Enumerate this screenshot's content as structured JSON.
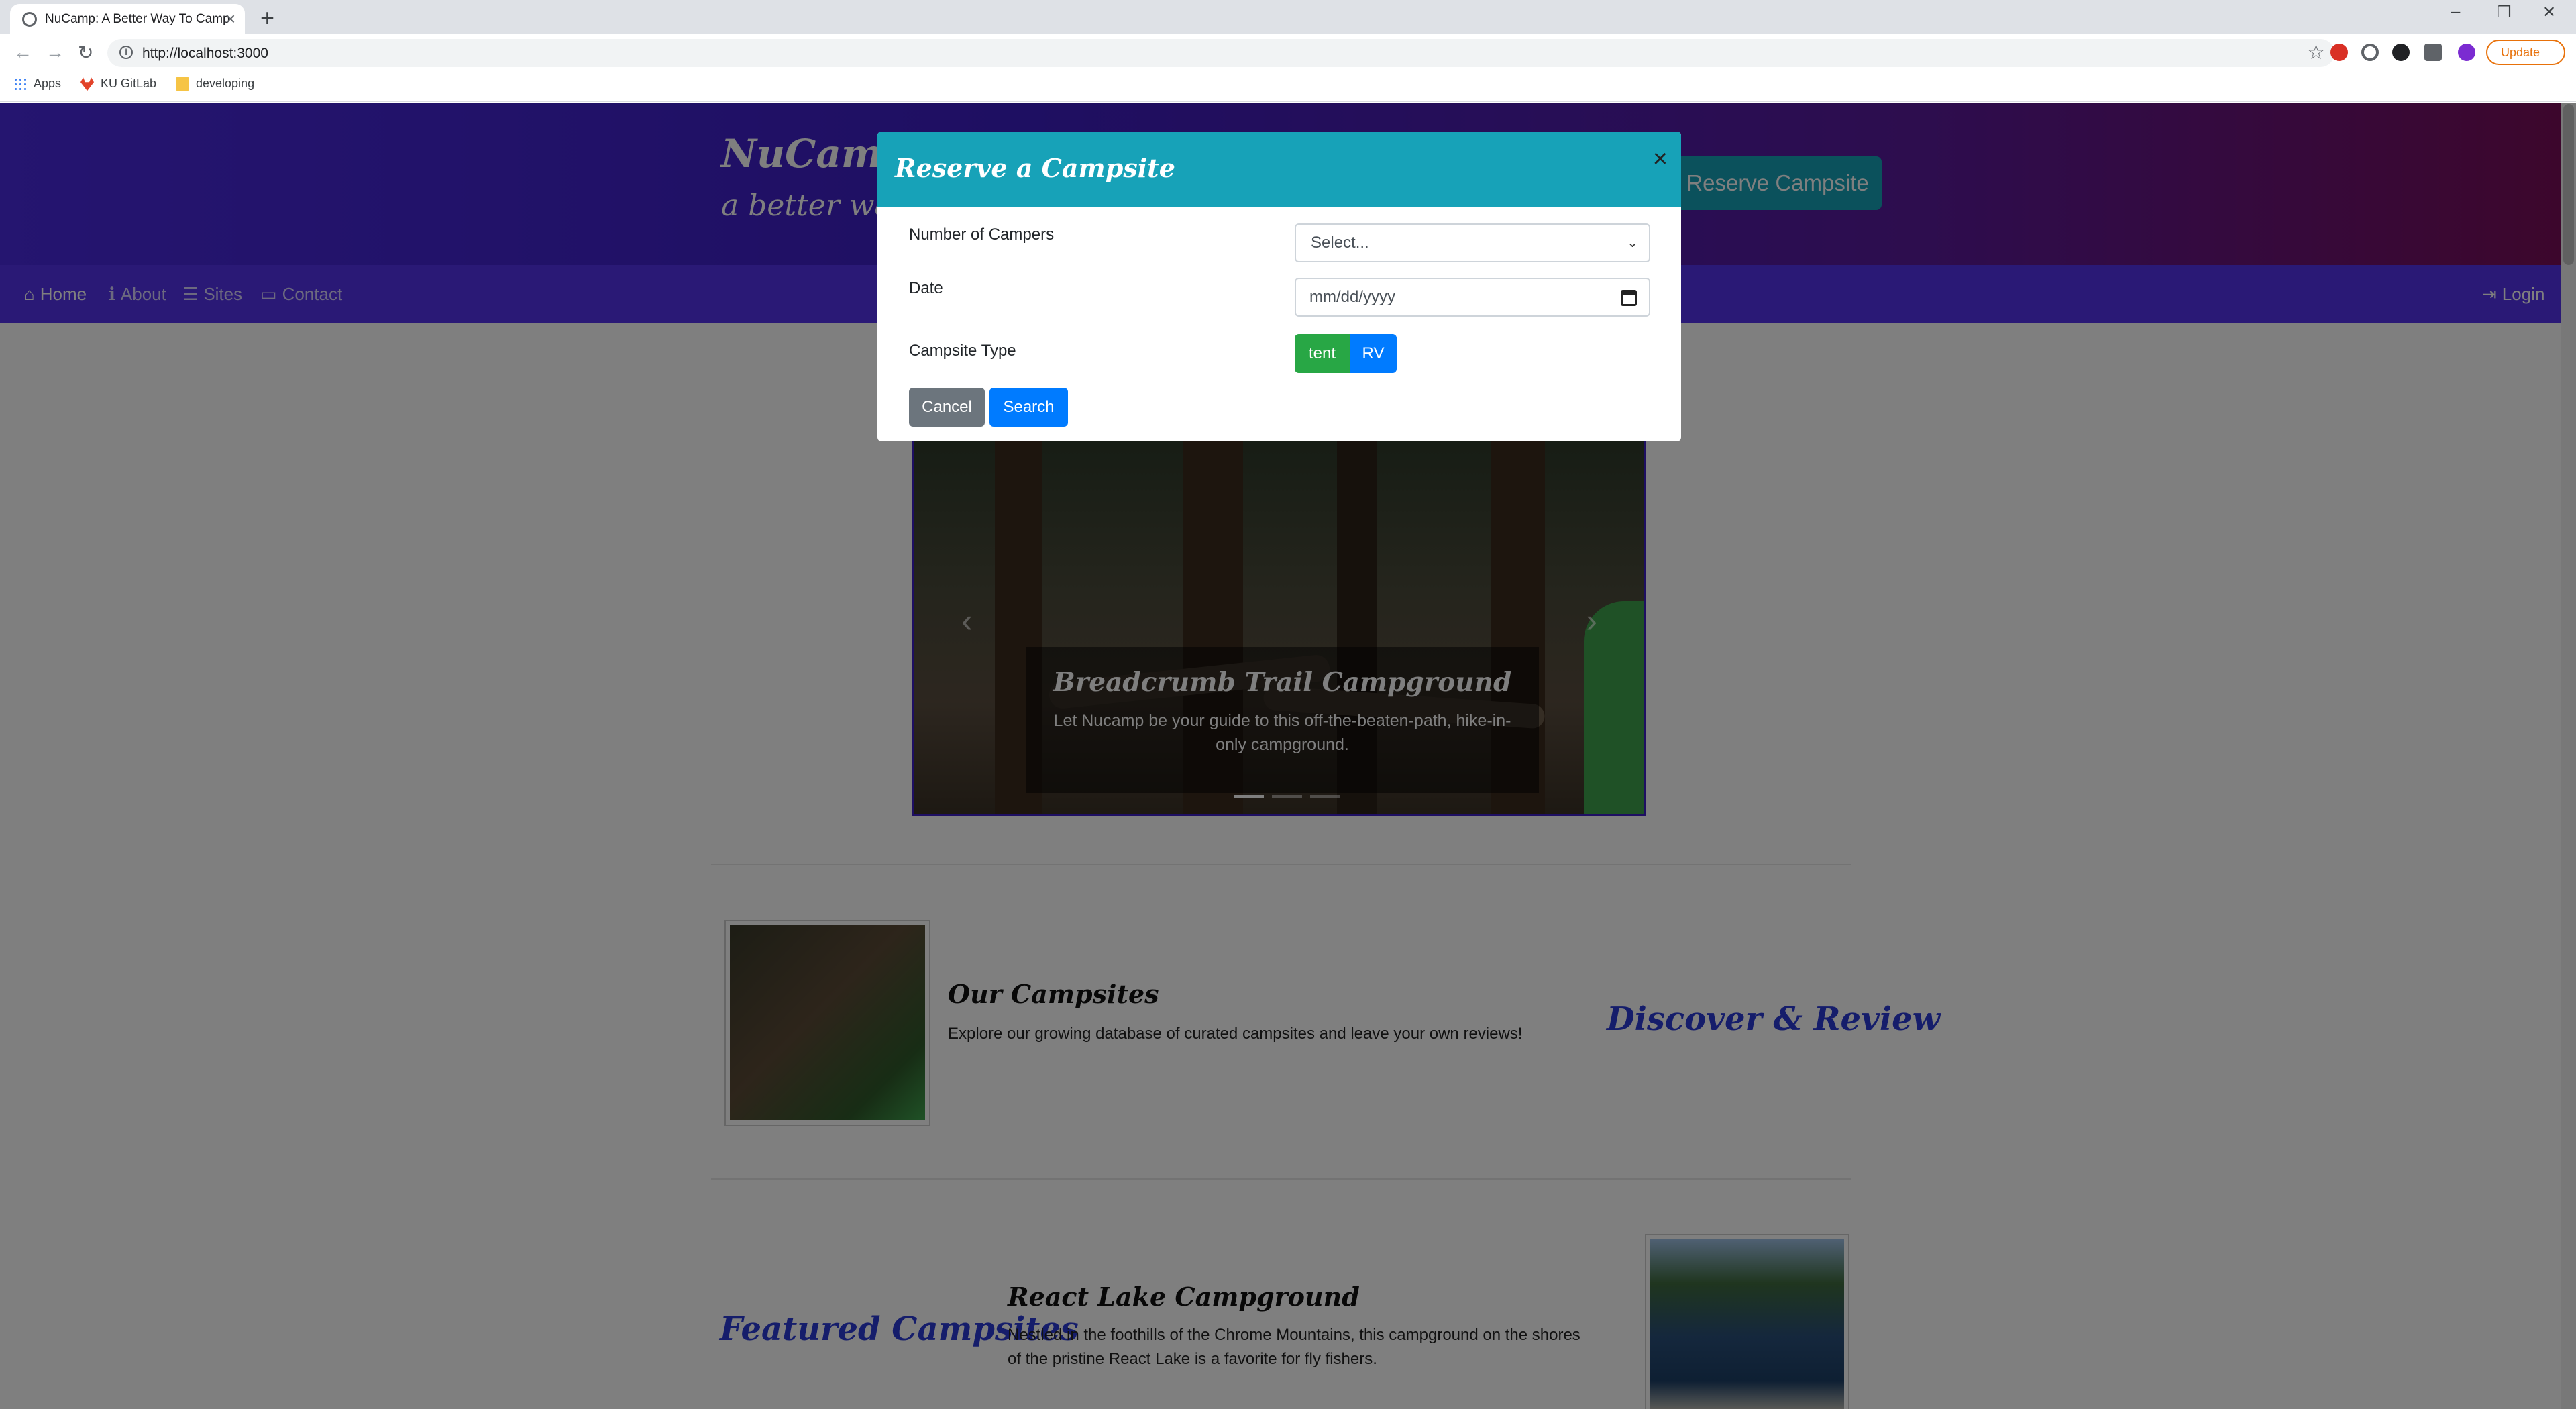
{
  "browser": {
    "tab_title": "NuCamp: A Better Way To Camp",
    "url": "http://localhost:3000",
    "update_label": "Update",
    "bookmarks": [
      "Apps",
      "KU GitLab",
      "developing"
    ]
  },
  "header": {
    "brand": "NuCamp",
    "tagline": "a better way to camp",
    "reserve_label": "Reserve Campsite"
  },
  "nav": {
    "home": "Home",
    "about": "About",
    "sites": "Sites",
    "contact": "Contact",
    "login": "Login"
  },
  "carousel": {
    "title": "Breadcrumb Trail Campground",
    "text": "Let Nucamp be your guide to this off-the-beaten-path, hike-in-only campground."
  },
  "sections": {
    "campsites_title": "Our Campsites",
    "campsites_text": "Explore our growing database of curated campsites and leave your own reviews!",
    "discover": "Discover & Review",
    "featured": "Featured Campsites",
    "react_title": "React Lake Campground",
    "react_text": "Nestled in the foothills of the Chrome Mountains, this campground on the shores of the pristine React Lake is a favorite for fly fishers."
  },
  "modal": {
    "title": "Reserve a Campsite",
    "close": "×",
    "campers_label": "Number of Campers",
    "campers_value": "Select...",
    "date_label": "Date",
    "date_placeholder": "mm/dd/yyyy",
    "type_label": "Campsite Type",
    "tent_label": "tent",
    "rv_label": "RV",
    "cancel_label": "Cancel",
    "search_label": "Search"
  },
  "colors": {
    "primary": "#007bff",
    "info": "#17a2b8",
    "success": "#28a745",
    "secondary": "#6c757d",
    "navbar": "#5533ec"
  }
}
